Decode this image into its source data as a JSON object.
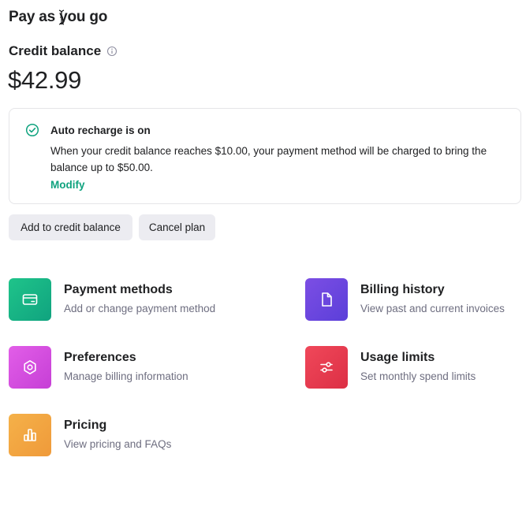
{
  "header": {
    "title": "Pay as you go"
  },
  "credit": {
    "title": "Credit balance",
    "amount": "$42.99"
  },
  "auto_recharge": {
    "title": "Auto recharge is on",
    "description": "When your credit balance reaches $10.00, your payment method will be charged to bring the balance up to $50.00.",
    "modify_label": "Modify",
    "accent_color": "#10a37f"
  },
  "actions": {
    "add_label": "Add to credit balance",
    "cancel_label": "Cancel plan"
  },
  "tiles": [
    {
      "title": "Payment methods",
      "subtitle": "Add or change payment method",
      "icon": "credit-card-icon",
      "color": "#19c37d"
    },
    {
      "title": "Billing history",
      "subtitle": "View past and current invoices",
      "icon": "document-icon",
      "color": "#715fde"
    },
    {
      "title": "Preferences",
      "subtitle": "Manage billing information",
      "icon": "gear-icon",
      "color": "#dd5ce5"
    },
    {
      "title": "Usage limits",
      "subtitle": "Set monthly spend limits",
      "icon": "sliders-icon",
      "color": "#ef4146"
    },
    {
      "title": "Pricing",
      "subtitle": "View pricing and FAQs",
      "icon": "bar-chart-icon",
      "color": "#f4ac36"
    }
  ]
}
